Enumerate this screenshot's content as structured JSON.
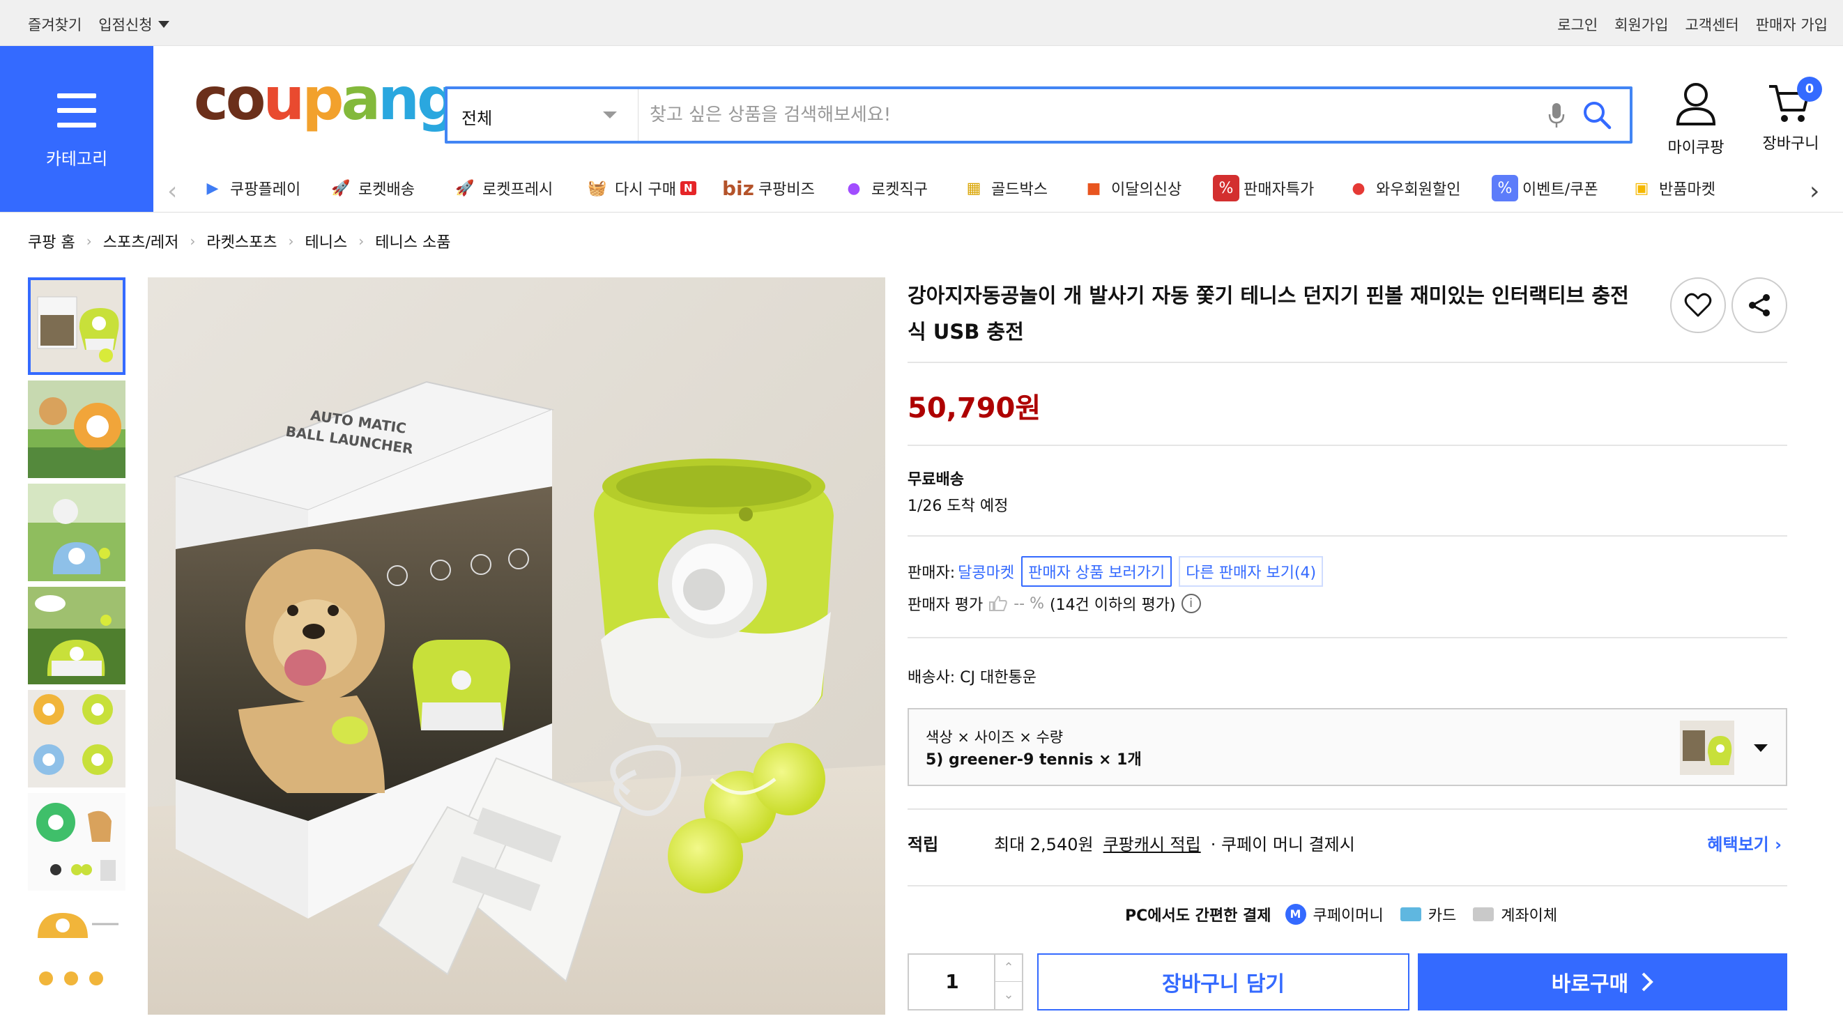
{
  "topbar": {
    "left": [
      "즐겨찾기",
      "입점신청"
    ],
    "right": [
      "로그인",
      "회원가입",
      "고객센터",
      "판매자 가입"
    ]
  },
  "category": {
    "label": "카테고리"
  },
  "logo": {
    "letters": [
      "c",
      "o",
      "u",
      "p",
      "a",
      "n",
      "g"
    ],
    "colors": [
      "#6b2f1a",
      "#6b2f1a",
      "#e94a2f",
      "#f2a12c",
      "#83b93b",
      "#2aa7df",
      "#2aa7df"
    ]
  },
  "search": {
    "category": "전체",
    "placeholder": "찾고 싶은 상품을 검색해보세요!"
  },
  "header": {
    "mypage": "마이쿠팡",
    "cart": "장바구니",
    "cart_count": "0"
  },
  "quick_menu": [
    {
      "label": "쿠팡플레이",
      "icon": "play-icon"
    },
    {
      "label": "로켓배송",
      "icon": "rocket-icon"
    },
    {
      "label": "로켓프레시",
      "icon": "rocket-fresh-icon"
    },
    {
      "label": "다시 구매",
      "icon": "basket-icon",
      "badge": "N"
    },
    {
      "label": "쿠팡비즈",
      "icon": "biz-icon",
      "prefix": "biz"
    },
    {
      "label": "로켓직구",
      "icon": "globe-rocket-icon"
    },
    {
      "label": "골드박스",
      "icon": "gold-box-icon"
    },
    {
      "label": "이달의신상",
      "icon": "new-bag-icon"
    },
    {
      "label": "판매자특가",
      "icon": "percent-icon"
    },
    {
      "label": "와우회원할인",
      "icon": "wow-icon"
    },
    {
      "label": "이벤트/쿠폰",
      "icon": "coupon-icon"
    },
    {
      "label": "반품마켓",
      "icon": "return-market-icon"
    }
  ],
  "breadcrumb": [
    "쿠팡 홈",
    "스포츠/레저",
    "라켓스포츠",
    "테니스",
    "테니스 소품"
  ],
  "product": {
    "title": "강아지자동공놀이 개 발사기 자동 쫓기 테니스 던지기 핀볼 재미있는 인터랙티브 충전식 USB 충전",
    "price": "50,790원",
    "shipping_label": "무료배송",
    "arrival": "1/26 도착 예정",
    "seller_prefix": "판매자:",
    "seller_name": "달콩마켓",
    "seller_products_btn": "판매자 상품 보러가기",
    "other_sellers_btn": "다른 판매자 보기(4)",
    "rating_label": "판매자 평가",
    "rating_value": "-- %",
    "rating_note": "(14건 이하의 평가)",
    "courier": "배송사:  CJ 대한통운",
    "option_label": "색상 × 사이즈 × 수량",
    "option_value": "5) greener-9 tennis × 1개",
    "reward_head": "적립",
    "reward_text": "최대 2,540원",
    "reward_link": "쿠팡캐시 적립",
    "reward_tail": "· 쿠페이 머니 결제시",
    "reward_more": "혜택보기 ›",
    "pay_head": "PC에서도 간편한 결제",
    "pay_money": "쿠페이머니",
    "pay_card": "카드",
    "pay_bank": "계좌이체",
    "qty": "1",
    "cart_btn": "장바구니 담기",
    "buy_btn": "바로구매"
  },
  "image_text": {
    "box_line1": "AUTO MATIC",
    "box_line2": "BALL LAUNCHER"
  },
  "colors": {
    "accent": "#346aff",
    "price": "#ae0000",
    "device": "#c8e03a"
  }
}
